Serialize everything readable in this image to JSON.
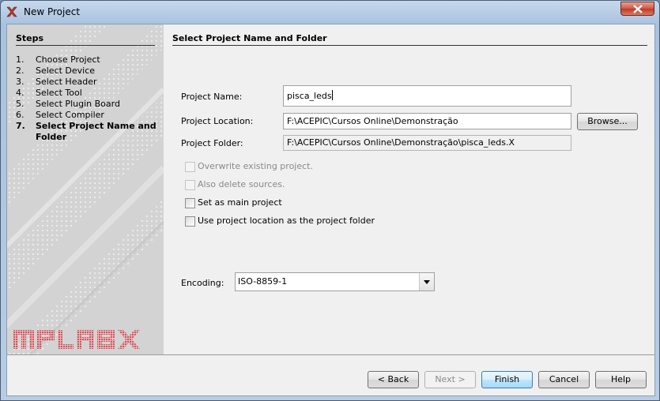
{
  "window": {
    "title": "New Project"
  },
  "steps": {
    "title": "Steps",
    "items": [
      {
        "num": "1.",
        "label": "Choose Project"
      },
      {
        "num": "2.",
        "label": "Select Device"
      },
      {
        "num": "3.",
        "label": "Select Header"
      },
      {
        "num": "4.",
        "label": "Select Tool"
      },
      {
        "num": "5.",
        "label": "Select Plugin Board"
      },
      {
        "num": "6.",
        "label": "Select Compiler"
      },
      {
        "num": "7.",
        "label": "Select Project Name and Folder",
        "active": true
      }
    ],
    "logo_text": "MPLABX"
  },
  "panel": {
    "title": "Select Project Name and Folder",
    "project_name": {
      "label": "Project Name:",
      "value": "pisca_leds"
    },
    "project_location": {
      "label": "Project Location:",
      "value": "F:\\ACEPIC\\Cursos Online\\Demonstração",
      "browse": "Browse..."
    },
    "project_folder": {
      "label": "Project Folder:",
      "value": "F:\\ACEPIC\\Cursos Online\\Demonstração\\pisca_leds.X"
    },
    "options": {
      "overwrite": {
        "label": "Overwrite existing project.",
        "checked": false,
        "enabled": false
      },
      "delete_sources": {
        "label": "Also delete sources.",
        "checked": false,
        "enabled": false
      },
      "main_project": {
        "label": "Set as main project",
        "checked": false,
        "enabled": true
      },
      "use_location": {
        "label": "Use project location as the project folder",
        "checked": false,
        "enabled": true
      }
    },
    "encoding": {
      "label": "Encoding:",
      "value": "ISO-8859-1"
    }
  },
  "buttons": {
    "back": "< Back",
    "next": "Next >",
    "finish": "Finish",
    "cancel": "Cancel",
    "help": "Help"
  },
  "colors": {
    "close_button": "#c0392b",
    "default_button_border": "#3c7fb1",
    "logo": "#e0505a"
  }
}
